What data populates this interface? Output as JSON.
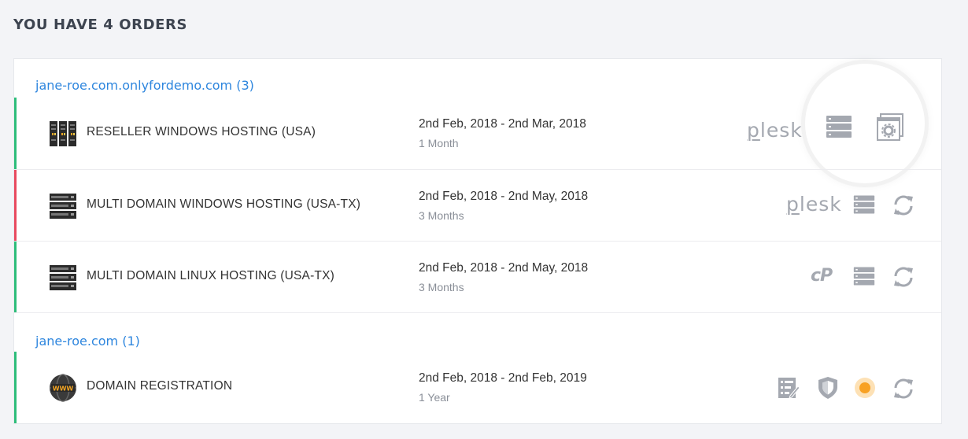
{
  "page": {
    "title": "YOU HAVE 4 ORDERS"
  },
  "groups": [
    {
      "name": "jane-roe.com.onlyfordemo.com (3)",
      "orders": [
        {
          "name": "RESELLER WINDOWS HOSTING (USA)",
          "dates": "2nd Feb, 2018 - 2nd Mar, 2018",
          "duration": "1 Month",
          "status_color": "#2dbd7a",
          "panel": "plesk",
          "actions": [
            "server-list-icon",
            "settings-window-icon"
          ]
        },
        {
          "name": "MULTI DOMAIN WINDOWS HOSTING (USA-TX)",
          "dates": "2nd Feb, 2018 - 2nd May, 2018",
          "duration": "3 Months",
          "status_color": "#e84a5f",
          "panel": "plesk",
          "actions": [
            "server-list-icon",
            "renew-icon"
          ]
        },
        {
          "name": "MULTI DOMAIN LINUX HOSTING (USA-TX)",
          "dates": "2nd Feb, 2018 - 2nd May, 2018",
          "duration": "3 Months",
          "status_color": "#2dbd7a",
          "panel": "cP",
          "actions": [
            "server-list-icon",
            "renew-icon"
          ]
        }
      ]
    },
    {
      "name": "jane-roe.com (1)",
      "orders": [
        {
          "name": "DOMAIN REGISTRATION",
          "dates": "2nd Feb, 2018 - 2nd Feb, 2019",
          "duration": "1 Year",
          "status_color": "#2dbd7a",
          "actions": [
            "dns-records-icon",
            "privacy-shield-icon",
            "status-dot-icon",
            "renew-icon"
          ]
        }
      ]
    }
  ],
  "panel_labels": {
    "plesk": "plesk",
    "cpanel": "cP"
  },
  "colors": {
    "accent": "#2e86de",
    "active": "#2dbd7a",
    "suspended": "#e84a5f",
    "pending": "#f8a123",
    "icon": "#a4a8b0"
  }
}
